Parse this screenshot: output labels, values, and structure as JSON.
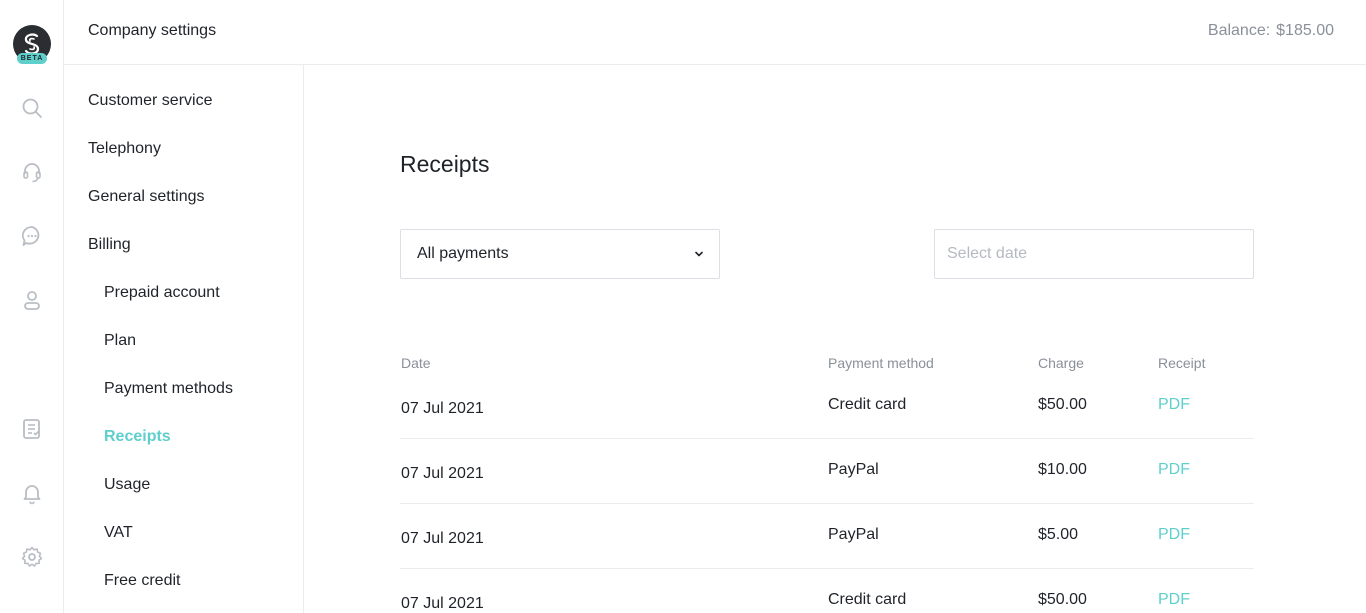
{
  "app": {
    "logo_badge": "BETA",
    "accent_color": "#5fcfcc"
  },
  "rail": {
    "icons": [
      "search-icon",
      "headset-icon",
      "chat-icon",
      "contact-icon",
      "reports-icon",
      "bell-icon",
      "gear-icon"
    ]
  },
  "header": {
    "title": "Company settings",
    "balance_label": "Balance:",
    "balance_value": "$185.00"
  },
  "settings_nav": {
    "items": [
      {
        "label": "Customer service",
        "level": 1
      },
      {
        "label": "Telephony",
        "level": 1
      },
      {
        "label": "General settings",
        "level": 1
      },
      {
        "label": "Billing",
        "level": 1
      },
      {
        "label": "Prepaid account",
        "level": 2
      },
      {
        "label": "Plan",
        "level": 2
      },
      {
        "label": "Payment methods",
        "level": 2
      },
      {
        "label": "Receipts",
        "level": 2,
        "active": true
      },
      {
        "label": "Usage",
        "level": 2
      },
      {
        "label": "VAT",
        "level": 2
      },
      {
        "label": "Free credit",
        "level": 2
      }
    ]
  },
  "main": {
    "title": "Receipts",
    "filter": {
      "selected": "All payments"
    },
    "date_filter": {
      "placeholder": "Select date",
      "value": ""
    },
    "table": {
      "columns": [
        "Date",
        "Payment method",
        "Charge",
        "Receipt"
      ],
      "rows": [
        {
          "date": "07 Jul 2021",
          "method": "Credit card",
          "charge": "$50.00",
          "receipt": "PDF"
        },
        {
          "date": "07 Jul 2021",
          "method": "PayPal",
          "charge": "$10.00",
          "receipt": "PDF"
        },
        {
          "date": "07 Jul 2021",
          "method": "PayPal",
          "charge": "$5.00",
          "receipt": "PDF"
        },
        {
          "date": "07 Jul 2021",
          "method": "Credit card",
          "charge": "$50.00",
          "receipt": "PDF"
        }
      ]
    }
  }
}
